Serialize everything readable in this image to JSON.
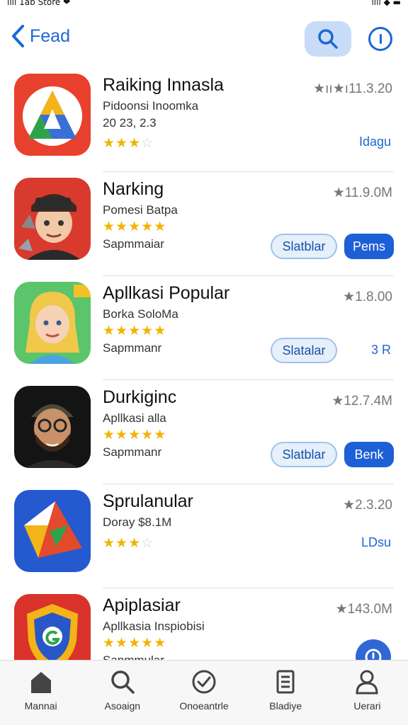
{
  "status_bar": {
    "carrier": "ıılı 1ab Store ❤",
    "right": "ııll ◆ ▬"
  },
  "nav": {
    "back_label": "Fead"
  },
  "apps": [
    {
      "name": "Raiking Innasla",
      "line1": "Pidoonsi Inoomka",
      "line2": "20 23, 2.3",
      "stars_on": "★★★",
      "stars_off": "☆",
      "rating": "★ıı★ı11.3.20",
      "link": "Idagu"
    },
    {
      "name": "Narking",
      "line1": "Pomesi Batpa",
      "stars_on": "★★★★★",
      "stars_off": "",
      "line2": "Sapmmaiar",
      "rating": "★11.9.0M",
      "btn_light": "Slatblar",
      "btn_dark": "Pems"
    },
    {
      "name": "Apllkasi Popular",
      "line1": "Borka SoloMa",
      "stars_on": "★★★★★",
      "stars_off": "",
      "line2": "Sapmmanr",
      "rating": "★1.8.00",
      "btn_light": "Slatalar",
      "link": "3 R"
    },
    {
      "name": "Durkiginc",
      "line1": "Apllkasi alla",
      "stars_on": "★★★★★",
      "stars_off": "",
      "line2": "Sapmmanr",
      "rating": "★12.7.4M",
      "btn_light": "Slatblar",
      "btn_dark": "Benk"
    },
    {
      "name": "Sprulanular",
      "line1": "Doray $8.1M",
      "stars_on": "★★★",
      "stars_off": "☆",
      "rating": "★2.3.20",
      "link": "LDsu"
    },
    {
      "name": "Apiplasiar",
      "line1": "Apllkasia Inspiobisi",
      "stars_on": "★★★★★",
      "stars_off": "",
      "line2": "Sapmmular",
      "rating": "★143.0M"
    }
  ],
  "tabs": [
    {
      "label": "Mannai",
      "icon": "home-icon"
    },
    {
      "label": "Asoaign",
      "icon": "search-icon"
    },
    {
      "label": "Onoeantrle",
      "icon": "check-icon"
    },
    {
      "label": "Bladiye",
      "icon": "library-icon"
    },
    {
      "label": "Uerari",
      "icon": "user-icon"
    }
  ],
  "colors": {
    "accent": "#1d66d6",
    "star": "#f2b400",
    "search_bg": "#c9dcf7"
  }
}
